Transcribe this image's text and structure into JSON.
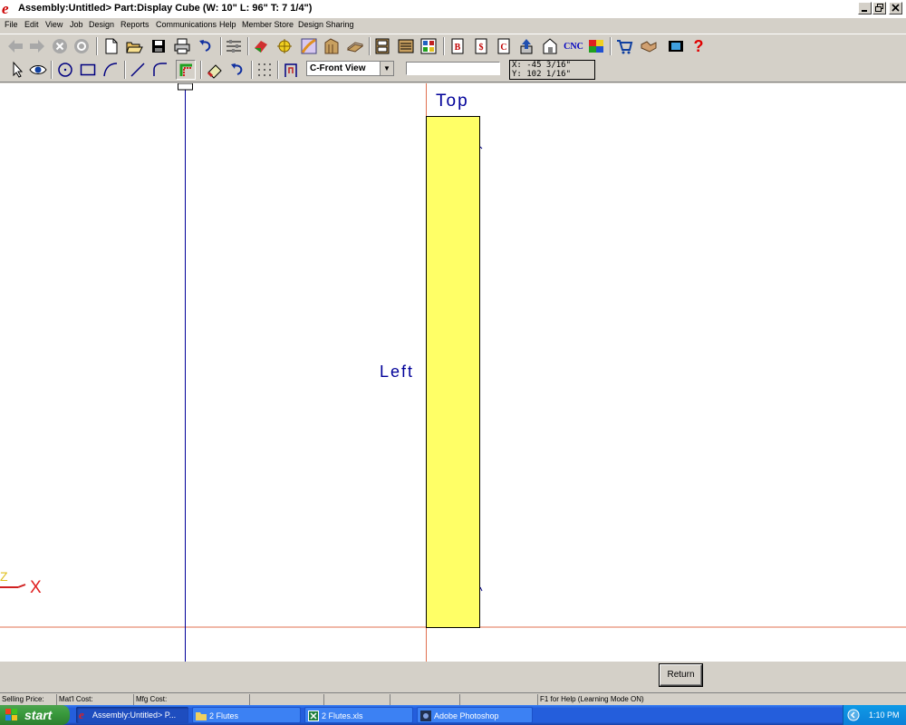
{
  "window": {
    "title": "Assembly:Untitled> Part:Display Cube (W: 10\" L: 96\" T: 7 1/4\")",
    "logo_letter": "e"
  },
  "menu": {
    "items": [
      "File",
      "Edit",
      "View",
      "Job",
      "Design",
      "Reports",
      "Communications",
      "Help",
      "Member Store",
      "Design Sharing"
    ]
  },
  "toolbar": {
    "cnc_label": "CNC",
    "help_glyph": "?",
    "icons_row1": [
      "back-arrow-icon",
      "forward-arrow-icon",
      "cancel-icon",
      "refresh-icon",
      "new-document-icon",
      "open-folder-icon",
      "save-icon",
      "print-icon",
      "undo-icon",
      "settings-sliders-icon",
      "parts-icon",
      "hardware-icon",
      "materials-icon",
      "moulding-icon",
      "edgeband-icon",
      "cabinet-icon",
      "cabinet-list-icon",
      "cutlist-icon",
      "b-report-icon",
      "dollar-report-icon",
      "c-report-icon",
      "upload-icon",
      "export-icon",
      "cnc-icon",
      "color-icon",
      "shopping-cart-icon",
      "handshake-icon",
      "film-icon",
      "help-icon"
    ],
    "icons_row2": [
      "select-arrow-icon",
      "view-eye-icon",
      "circle-icon",
      "rectangle-icon",
      "arc-icon",
      "line-icon",
      "fillet-icon",
      "corner-icon",
      "eraser-icon",
      "undo-icon",
      "grid-icon",
      "dimension-icon"
    ]
  },
  "view_select": {
    "selected": "C-Front View"
  },
  "coords": {
    "x": "X: -45 3/16\"",
    "y": "Y: 102 1/16\""
  },
  "canvas": {
    "top_label": "Top",
    "left_label": "Left",
    "axis_z": "Z",
    "axis_x": "X",
    "part_color": "#ffff66",
    "origin_line_color": "#e07050",
    "guide_line_color": "#000099"
  },
  "return_button": {
    "label": "Return"
  },
  "status": {
    "selling_price": "Selling Price:",
    "matl_cost": "Mat'l Cost:",
    "mfg_cost": "Mfg Cost:",
    "help": "F1 for Help (Learning Mode ON)"
  },
  "taskbar": {
    "start": "start",
    "tasks": [
      {
        "label": "Assembly:Untitled> P...",
        "icon": "app-e-icon"
      },
      {
        "label": "2 Flutes",
        "icon": "folder-icon"
      },
      {
        "label": "2 Flutes.xls",
        "icon": "excel-icon"
      },
      {
        "label": "Adobe Photoshop",
        "icon": "photoshop-icon"
      }
    ],
    "clock": "1:10 PM"
  }
}
